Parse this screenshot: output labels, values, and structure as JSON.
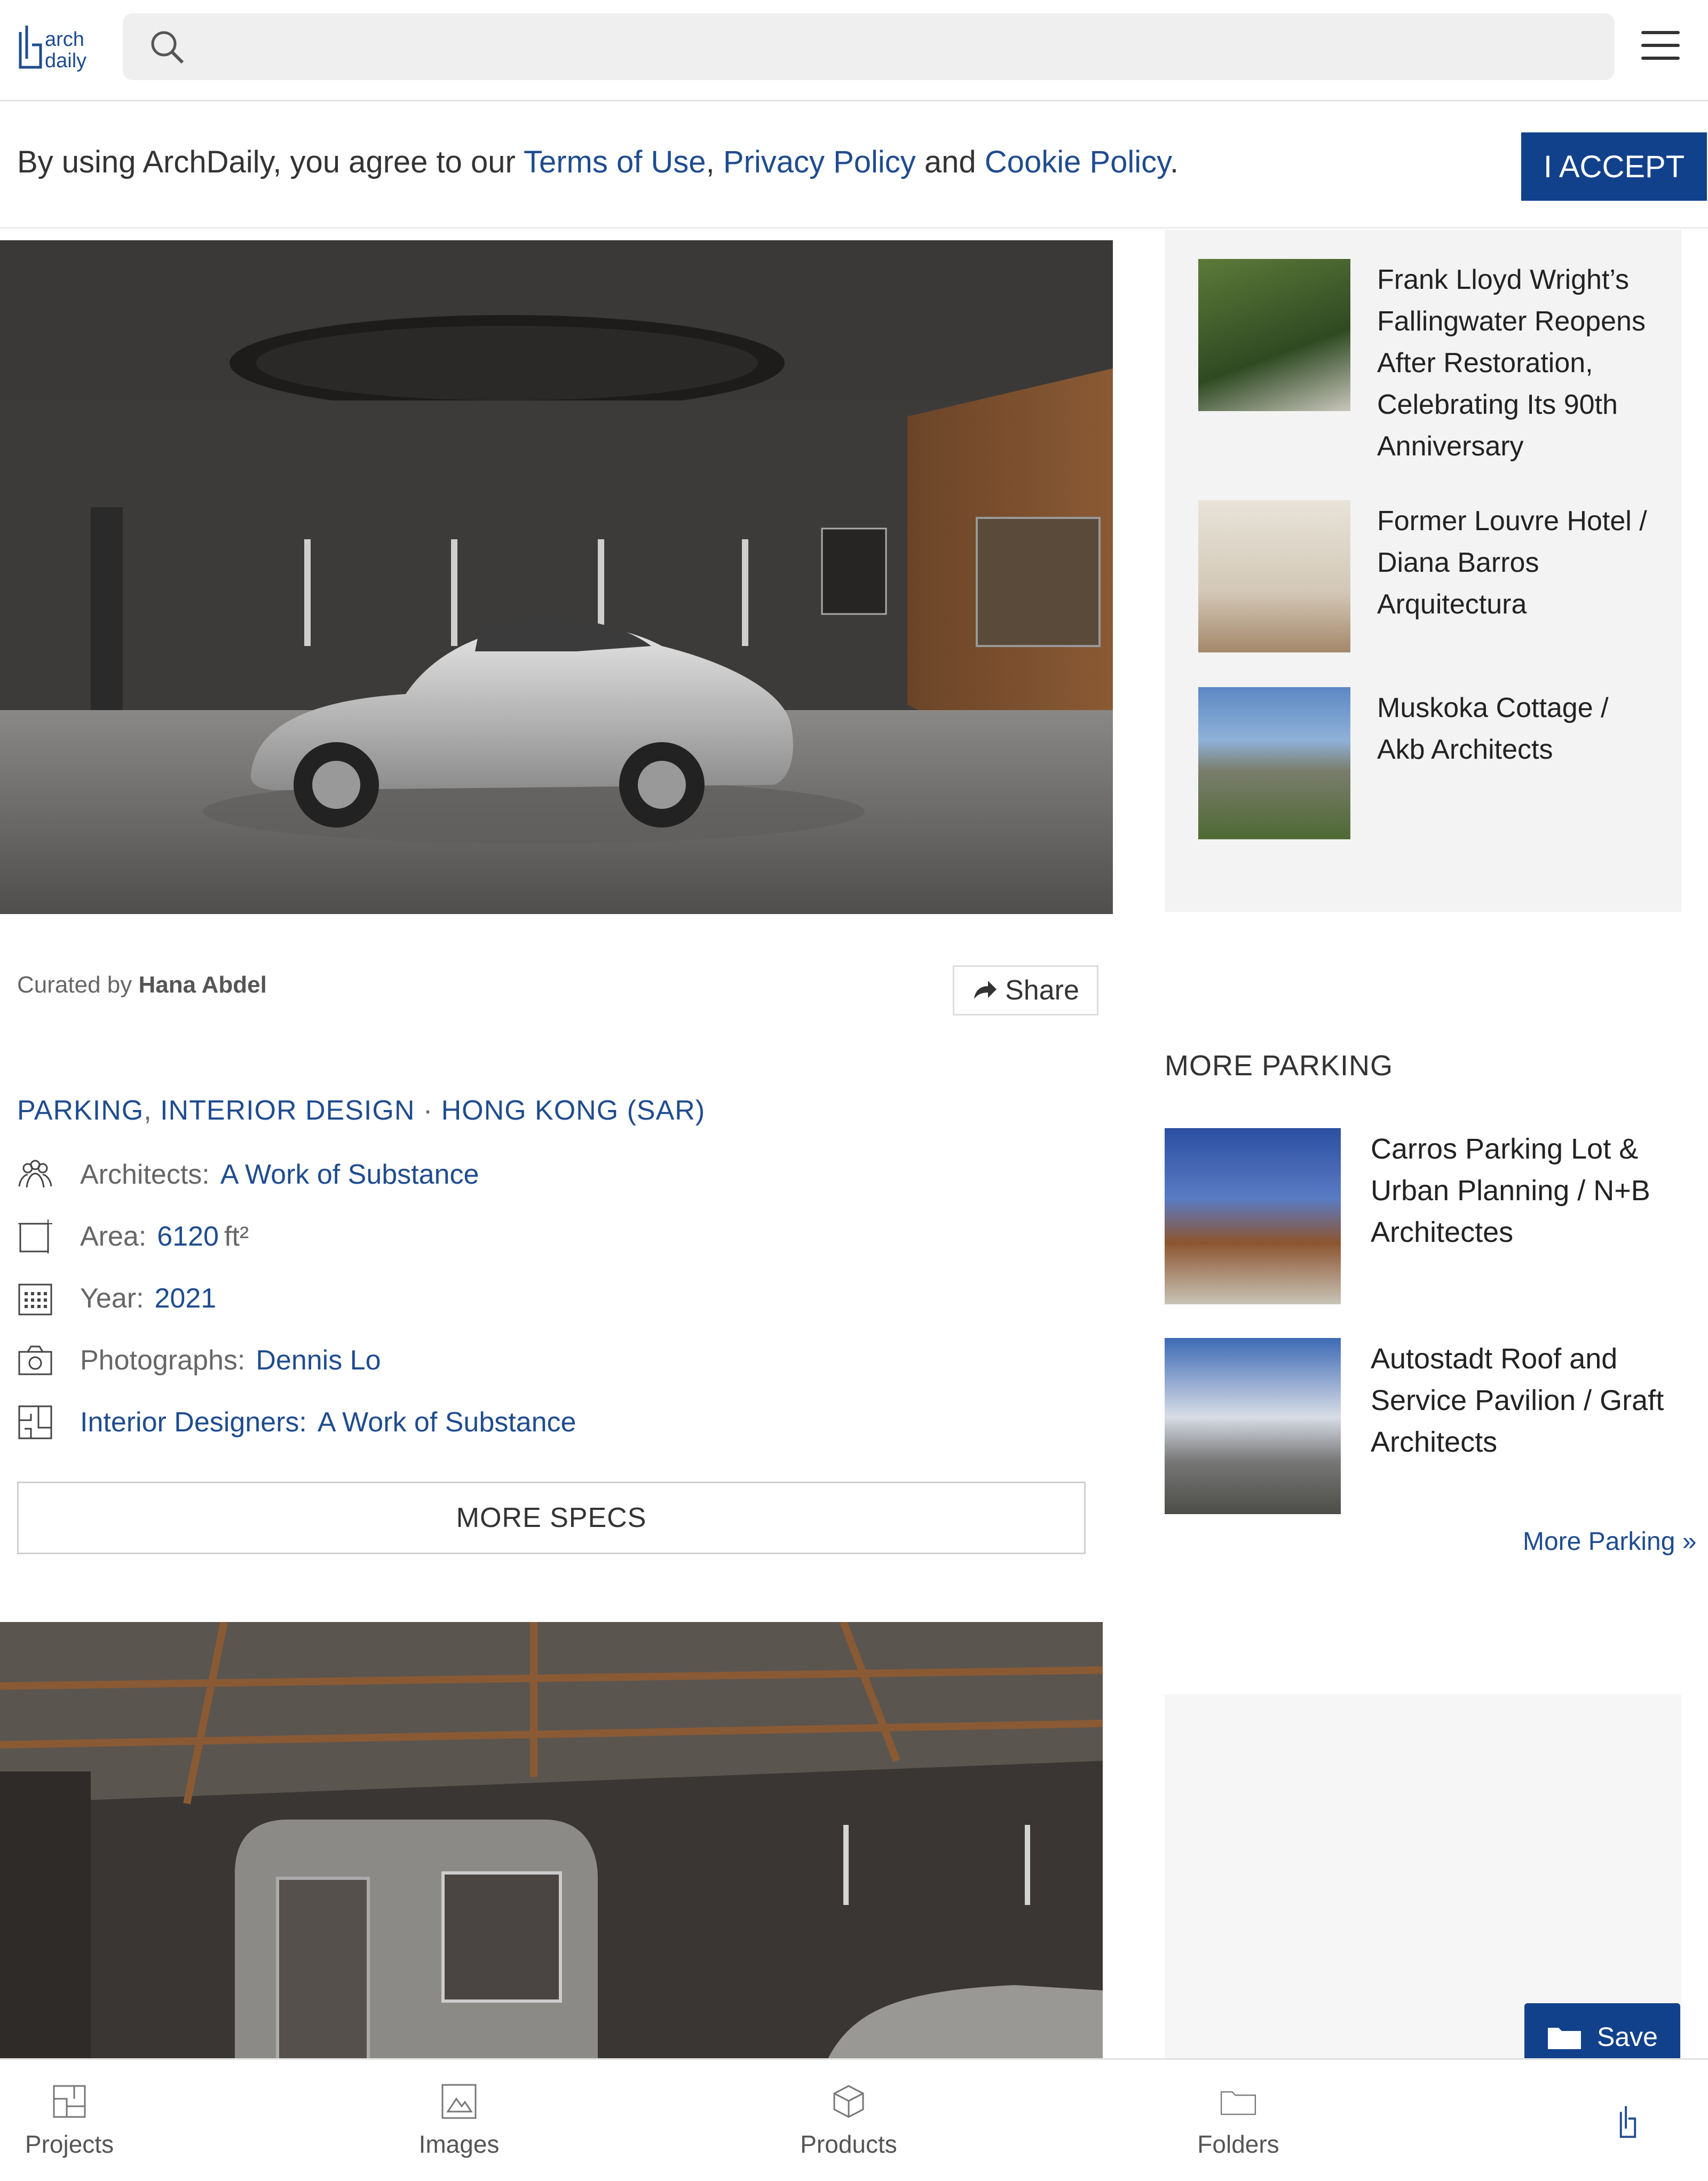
{
  "header": {
    "logo_text_line1": "arch",
    "logo_text_line2": "daily",
    "search_placeholder": "",
    "search_icon": "search-icon",
    "menu_icon": "hamburger-menu-icon"
  },
  "cookie_banner": {
    "text_before": "By using ArchDaily, you agree to our ",
    "terms": "Terms of Use",
    "comma": ", ",
    "privacy": "Privacy Policy",
    "and": " and ",
    "cookie": "Cookie Policy",
    "period": ".",
    "accept_label": "I ACCEPT"
  },
  "sidebar_related": [
    {
      "title": "Frank Lloyd Wright’s Fallingwater Reopens After Restoration, Celebrating Its 90th Anniversary"
    },
    {
      "title": "Former Louvre Hotel / Diana Barros Arquitectura"
    },
    {
      "title": "Muskoka Cottage / Akb Architects"
    }
  ],
  "article": {
    "curated_prefix": "Curated by",
    "curator": "Hana Abdel",
    "share_label": "Share",
    "tags": [
      "PARKING",
      "INTERIOR DESIGN",
      "HONG KONG (SAR)"
    ],
    "specs": [
      {
        "label": "Architects:",
        "value": "A Work of Substance",
        "icon": "people-icon"
      },
      {
        "label": "Area:",
        "value": "6120",
        "unit": "ft²",
        "icon": "area-icon"
      },
      {
        "label": "Year:",
        "value": "2021",
        "icon": "calendar-icon"
      },
      {
        "label": "Photographs:",
        "value": "Dennis Lo",
        "icon": "camera-icon"
      },
      {
        "label": "Interior Designers:",
        "value": "A Work of Substance",
        "icon": "floorplan-icon"
      }
    ],
    "more_specs_label": "MORE SPECS"
  },
  "more_parking": {
    "title": "MORE PARKING",
    "items": [
      {
        "title": "Carros Parking Lot & Urban Planning / N+B Architectes"
      },
      {
        "title": "Autostadt Roof and Service Pavilion / Graft Architects"
      }
    ],
    "link": "More Parking »"
  },
  "save_button": {
    "label": "Save",
    "icon": "folder-icon"
  },
  "bottom_nav": [
    {
      "label": "Projects",
      "icon": "projects-icon"
    },
    {
      "label": "Images",
      "icon": "images-icon"
    },
    {
      "label": "Products",
      "icon": "products-icon"
    },
    {
      "label": "Folders",
      "icon": "folders-icon"
    },
    {
      "label": "",
      "icon": "archdaily-logo-icon"
    }
  ],
  "colors": {
    "brand_blue": "#12418c",
    "link_blue": "#1f4c8f"
  }
}
